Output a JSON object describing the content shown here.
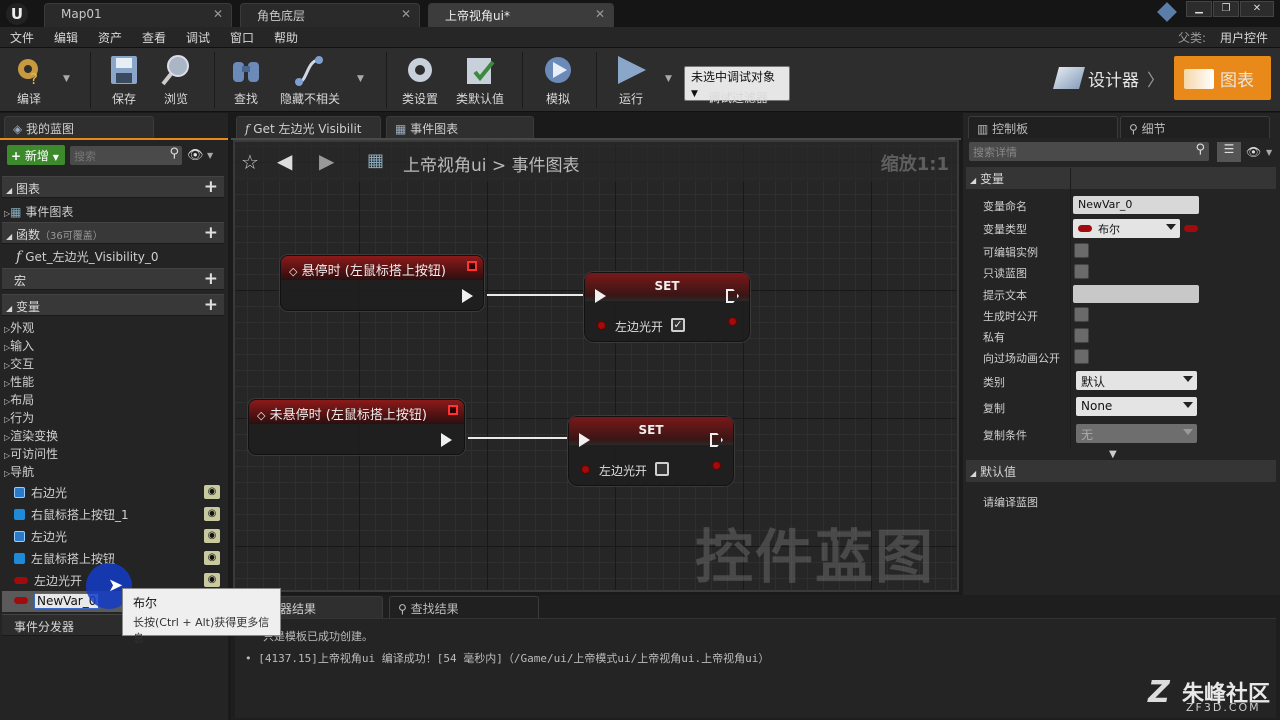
{
  "tabs": [
    {
      "label": "Map01"
    },
    {
      "label": "角色底层"
    },
    {
      "label": "上帝视角ui*"
    }
  ],
  "parent_class": {
    "label": "父类:",
    "value": "用户控件"
  },
  "menu": [
    "文件",
    "编辑",
    "资产",
    "查看",
    "调试",
    "窗口",
    "帮助"
  ],
  "toolbar": {
    "compile": "编译",
    "save": "保存",
    "browse": "浏览",
    "find": "查找",
    "hide_unrelated": "隐藏不相关",
    "class_settings": "类设置",
    "class_defaults": "类默认值",
    "simulate": "模拟",
    "play": "运行",
    "debug_object": "未选中调试对象",
    "debug_filter": "调试过滤器",
    "designer": "设计器",
    "graph": "图表"
  },
  "left_panel": {
    "tab": "我的蓝图",
    "new_button": "新增",
    "search_placeholder": "搜索",
    "sections": {
      "graphs": "图表",
      "event_graph": "事件图表",
      "functions": "函数",
      "functions_note": "（36可覆盖）",
      "function_item": "Get_左边光_Visibility_0",
      "macros": "宏",
      "variables": "变量",
      "event_dispatchers": "事件分发器"
    },
    "categories": [
      "外观",
      "输入",
      "交互",
      "性能",
      "布局",
      "行为",
      "渲染变换",
      "可访问性",
      "导航"
    ],
    "variables": [
      {
        "name": "右边光",
        "type": "widget"
      },
      {
        "name": "右鼠标搭上按钮_1",
        "type": "button"
      },
      {
        "name": "左边光",
        "type": "widget"
      },
      {
        "name": "左鼠标搭上按钮",
        "type": "button"
      },
      {
        "name": "左边光开",
        "type": "bool"
      },
      {
        "name": "NewVar_0",
        "type": "bool"
      }
    ]
  },
  "graph_tabs": {
    "function_tab": "Get 左边光 Visibilit",
    "event_tab": "事件图表"
  },
  "breadcrumb": {
    "blueprint": "上帝视角ui",
    "separator": ">",
    "graph": "事件图表"
  },
  "zoom": "缩放1:1",
  "watermark": "控件蓝图",
  "nodes": {
    "hover_event": "悬停时 (左鼠标搭上按钮)",
    "unhover_event": "未悬停时 (左鼠标搭上按钮)",
    "set_title": "SET",
    "set_var": "左边光开"
  },
  "right_panel": {
    "palette_tab": "控制板",
    "details_tab": "细节",
    "search_placeholder": "搜索详情",
    "variable_section": "变量",
    "rows": {
      "var_name_label": "变量命名",
      "var_name_value": "NewVar_0",
      "var_type_label": "变量类型",
      "var_type_value": "布尔",
      "editable_label": "可编辑实例",
      "readonly_label": "只读蓝图",
      "tooltip_label": "提示文本",
      "expose_label": "生成时公开",
      "private_label": "私有",
      "cinematic_label": "向过场动画公开",
      "category_label": "类别",
      "category_value": "默认",
      "replication_label": "复制",
      "replication_value": "None",
      "repcond_label": "复制条件",
      "repcond_value": "无"
    },
    "default_section": "默认值",
    "default_note": "请编译蓝图"
  },
  "bottom": {
    "compiler_tab": "器结果",
    "find_tab": "查找结果",
    "log_line1": "只是模板已成功创建。",
    "log_line2": "[4137.15]上帝视角ui 编译成功！[54 毫秒内]（/Game/ui/上帝模式ui/上帝视角ui.上帝视角ui）"
  },
  "tooltip": {
    "title": "布尔",
    "hint": "长按(Ctrl + Alt)获得更多信息"
  },
  "brand": {
    "name": "朱峰社区",
    "url": "ZF3D.COM"
  }
}
